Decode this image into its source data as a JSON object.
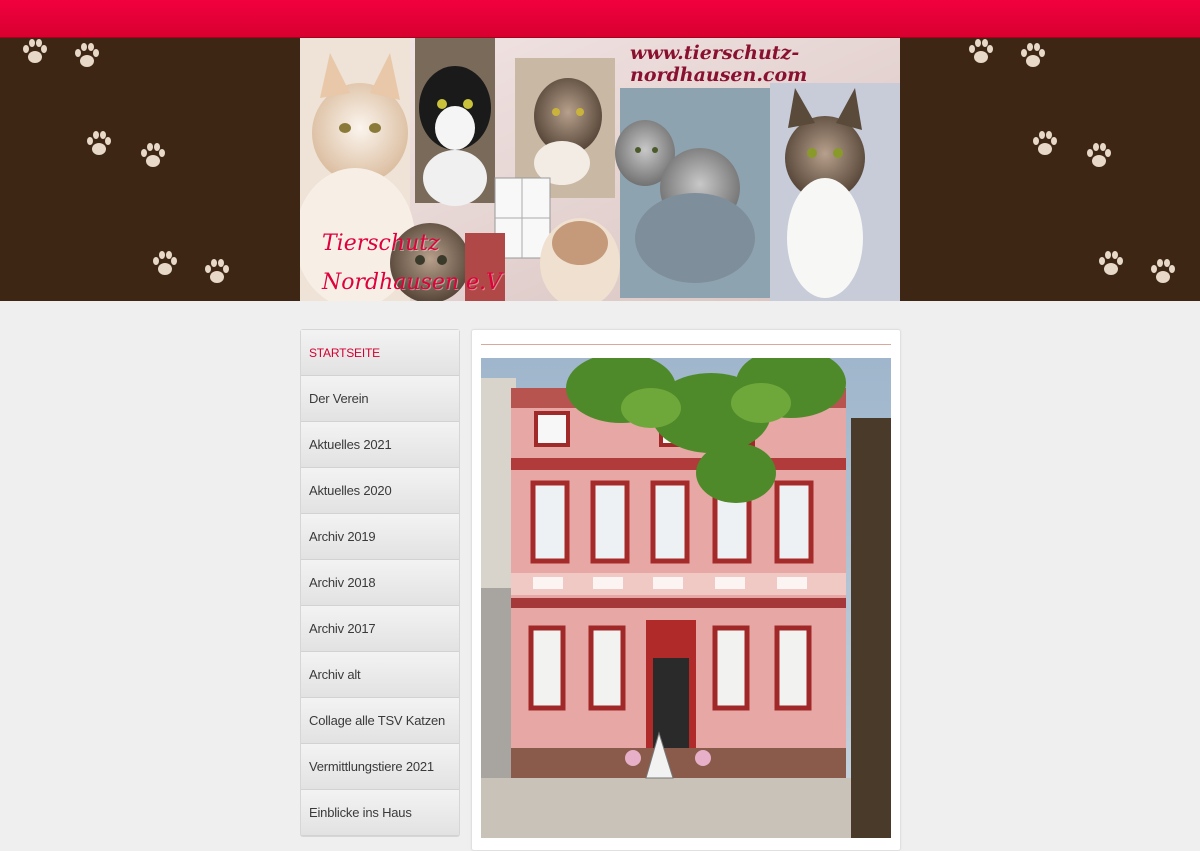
{
  "header": {
    "url": "www.tierschutz-nordhausen.com",
    "brand_line1": "Tierschutz",
    "brand_line2": "Nordhausen e.V"
  },
  "nav": {
    "items": [
      {
        "label": "STARTSEITE",
        "active": true
      },
      {
        "label": "Der Verein"
      },
      {
        "label": "Aktuelles 2021"
      },
      {
        "label": "Aktuelles 2020"
      },
      {
        "label": "Archiv 2019"
      },
      {
        "label": "Archiv 2018"
      },
      {
        "label": "Archiv 2017"
      },
      {
        "label": "Archiv alt"
      },
      {
        "label": "Collage alle TSV Katzen"
      },
      {
        "label": "Vermittlungstiere 2021"
      },
      {
        "label": "Einblicke ins Haus"
      }
    ]
  },
  "colors": {
    "topbar": "#e8003a",
    "banner_bg": "#3d2714",
    "paw": "#e8d8c8",
    "active_nav": "#d2002f"
  }
}
